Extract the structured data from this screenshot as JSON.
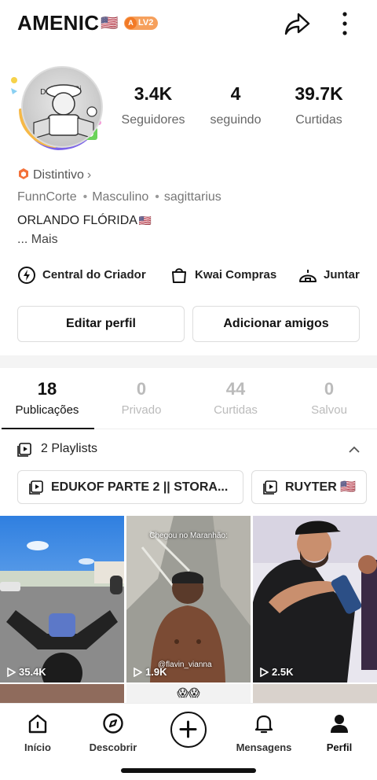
{
  "profile": {
    "username": "AMENIC",
    "username_flag": "🇺🇸",
    "level_badge": "LV2",
    "badge_label": "Distintivo",
    "tags": [
      "FunnCorte",
      "Masculino",
      "sagittarius"
    ],
    "location": "ORLANDO FLÓRIDA",
    "location_flag": "🇺🇸",
    "more_label": "... Mais"
  },
  "stats": [
    {
      "value": "3.4K",
      "label": "Seguidores"
    },
    {
      "value": "4",
      "label": "seguindo"
    },
    {
      "value": "39.7K",
      "label": "Curtidas"
    }
  ],
  "quick_links": [
    {
      "label": "Central do Criador",
      "icon": "lightning-icon"
    },
    {
      "label": "Kwai Compras",
      "icon": "shopping-bag-icon"
    },
    {
      "label": "Juntar",
      "icon": "dome-icon"
    }
  ],
  "buttons": {
    "edit_profile": "Editar perfil",
    "add_friends": "Adicionar amigos"
  },
  "tabs": [
    {
      "count": "18",
      "label": "Publicações",
      "active": true
    },
    {
      "count": "0",
      "label": "Privado",
      "active": false
    },
    {
      "count": "44",
      "label": "Curtidas",
      "active": false
    },
    {
      "count": "0",
      "label": "Salvou",
      "active": false
    }
  ],
  "playlists": {
    "header": "2 Playlists",
    "items": [
      {
        "label": "EDUKOF PARTE 2 || STORA..."
      },
      {
        "label": "RUYTER 🇺🇸"
      }
    ]
  },
  "videos": [
    {
      "views": "35.4K",
      "caption": ""
    },
    {
      "views": "1.9K",
      "caption": "Chegou no Maranhão:",
      "watermark": "@flavin_vianna"
    },
    {
      "views": "2.5K",
      "caption": ""
    }
  ],
  "row2_emoji": "😱😱",
  "nav": [
    {
      "label": "Início",
      "icon": "home-icon"
    },
    {
      "label": "Descobrir",
      "icon": "compass-icon"
    },
    {
      "label": "",
      "icon": "plus-icon"
    },
    {
      "label": "Mensagens",
      "icon": "bell-icon"
    },
    {
      "label": "Perfil",
      "icon": "person-icon"
    }
  ],
  "colors": {
    "accent": "#f27a26",
    "text": "#111111",
    "muted": "#777777"
  }
}
